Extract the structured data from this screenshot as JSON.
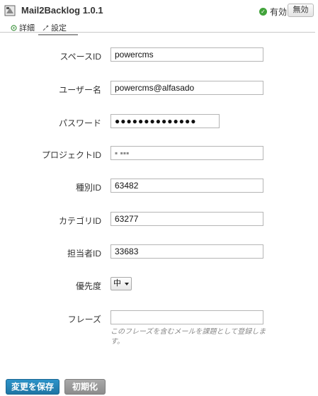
{
  "header": {
    "title": "Mail2Backlog 1.0.1",
    "status_label": "有効",
    "disable_button": "無効",
    "plugin_icon": "plugin-icon",
    "status_icon": "check-circle-icon"
  },
  "tabs": [
    {
      "label": "詳細",
      "icon": "details-icon"
    },
    {
      "label": "設定",
      "icon": "settings-icon",
      "active": true
    }
  ],
  "form": {
    "space_id": {
      "label": "スペースID",
      "value": "powercms"
    },
    "user_name": {
      "label": "ユーザー名",
      "value": "powercms@alfasado"
    },
    "password": {
      "label": "パスワード",
      "value": "●●●●●●●●●●●●●●"
    },
    "project_id": {
      "label": "プロジェクトID",
      "value": "▪ ▪▪▪"
    },
    "type_id": {
      "label": "種別ID",
      "value": "63482"
    },
    "category_id": {
      "label": "カテゴリID",
      "value": "63277"
    },
    "assignee_id": {
      "label": "担当者ID",
      "value": "33683"
    },
    "priority": {
      "label": "優先度",
      "value": "中"
    },
    "phrase": {
      "label": "フレーズ",
      "value": "",
      "hint": "このフレーズを含むメールを課題として登録します。"
    }
  },
  "actions": {
    "save": "変更を保存",
    "reset": "初期化"
  },
  "colors": {
    "save_button": "#1f7fb0",
    "reset_button": "#999999",
    "status_ok": "#41a33a"
  }
}
